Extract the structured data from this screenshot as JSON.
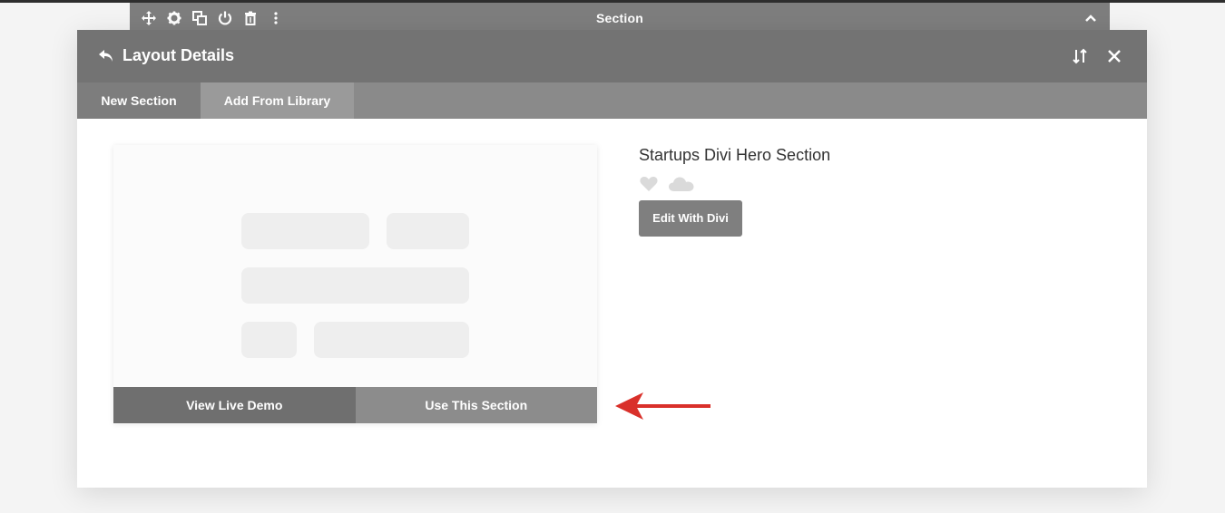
{
  "builder": {
    "section_bar_title": "Section"
  },
  "modal": {
    "title": "Layout Details",
    "tabs": [
      {
        "label": "New Section"
      },
      {
        "label": "Add From Library"
      }
    ]
  },
  "preview": {
    "buttons": {
      "view_demo": "View Live Demo",
      "use_section": "Use This Section"
    }
  },
  "details": {
    "title": "Startups Divi Hero Section",
    "edit_label": "Edit With Divi"
  },
  "icons": {
    "toolbar": [
      "move-icon",
      "gear-icon",
      "duplicate-icon",
      "power-icon",
      "trash-icon",
      "more-vertical-icon"
    ],
    "header": [
      "back-icon",
      "sort-icon",
      "close-icon"
    ],
    "details": [
      "heart-icon",
      "cloud-icon"
    ]
  },
  "colors": {
    "header_bg": "#737373",
    "tab_active": "#9a9a9a",
    "arrow": "#d9302a"
  }
}
